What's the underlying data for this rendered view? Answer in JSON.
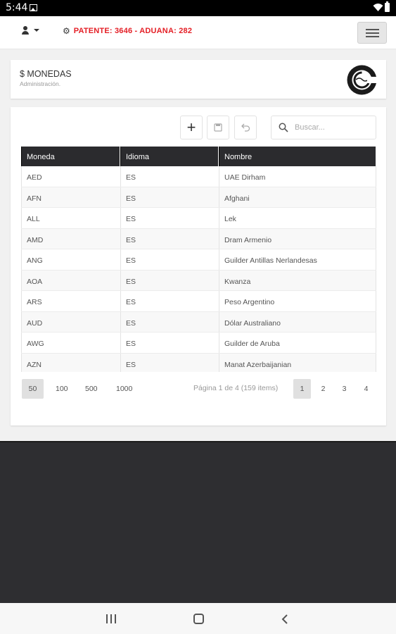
{
  "status_bar": {
    "time": "5:44"
  },
  "topnav": {
    "patente": "PATENTE: 3646 - ADUANA: 282"
  },
  "header": {
    "title": "$ MONEDAS",
    "subtitle": "Administración."
  },
  "toolbar": {
    "search_placeholder": "Buscar..."
  },
  "table": {
    "columns": [
      "Moneda",
      "Idioma",
      "Nombre"
    ],
    "rows": [
      [
        "AED",
        "ES",
        "UAE Dirham"
      ],
      [
        "AFN",
        "ES",
        "Afghani"
      ],
      [
        "ALL",
        "ES",
        "Lek"
      ],
      [
        "AMD",
        "ES",
        "Dram Armenio"
      ],
      [
        "ANG",
        "ES",
        "Guilder Antillas Nerlandesas"
      ],
      [
        "AOA",
        "ES",
        "Kwanza"
      ],
      [
        "ARS",
        "ES",
        "Peso Argentino"
      ],
      [
        "AUD",
        "ES",
        "Dólar Australiano"
      ],
      [
        "AWG",
        "ES",
        "Guilder de Aruba"
      ],
      [
        "AZN",
        "ES",
        "Manat Azerbaijanian"
      ]
    ]
  },
  "pager": {
    "sizes": [
      "50",
      "100",
      "500",
      "1000"
    ],
    "active_size": "50",
    "info": "Página 1 de 4 (159 items)",
    "pages": [
      "1",
      "2",
      "3",
      "4"
    ],
    "active_page": "1"
  },
  "icons": {
    "user": "user-icon",
    "gear": "gear-icon",
    "menu": "hamburger-icon",
    "add": "plus-icon",
    "save": "save-icon",
    "undo": "undo-icon",
    "search": "search-icon"
  },
  "colors": {
    "accent_red": "#e41e25",
    "grid_header": "#2b2b2e",
    "dark_area": "#2e2e31"
  }
}
